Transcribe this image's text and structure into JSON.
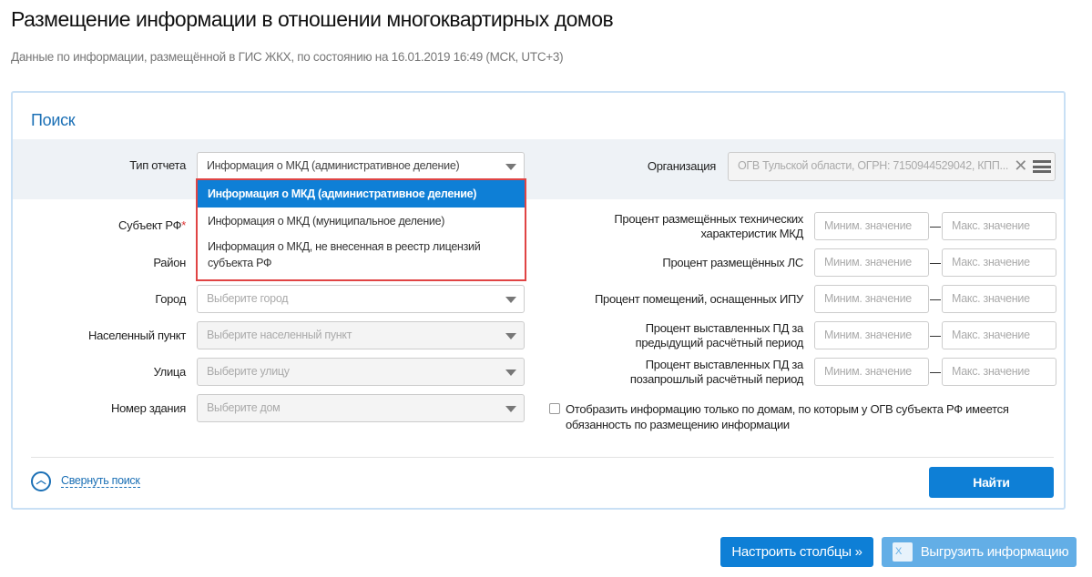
{
  "header": {
    "title": "Размещение информации в отношении многоквартирных домов",
    "subtitle": "Данные по информации, размещённой в ГИС ЖКХ, по состоянию на 16.01.2019 16:49 (МСК, UTC+3)"
  },
  "search": {
    "heading": "Поиск",
    "report_type": {
      "label": "Тип отчета",
      "value": "Информация о МКД (административное деление)",
      "options": [
        "Информация о МКД (административное деление)",
        "Информация о МКД (муниципальное деление)",
        "Информация о МКД, не внесенная в реестр лицензий субъекта РФ"
      ]
    },
    "organization": {
      "label": "Организация",
      "value": "ОГВ Тульской области, ОГРН: 7150944529042, КПП..."
    },
    "subject": {
      "label": "Субъект РФ",
      "required": "*"
    },
    "district": {
      "label": "Район"
    },
    "city": {
      "label": "Город",
      "placeholder": "Выберите город"
    },
    "settlement": {
      "label": "Населенный пункт",
      "placeholder": "Выберите населенный пункт"
    },
    "street": {
      "label": "Улица",
      "placeholder": "Выберите улицу"
    },
    "building": {
      "label": "Номер здания",
      "placeholder": "Выберите дом"
    },
    "ranges": [
      {
        "label": "Процент размещённых технических характеристик МКД",
        "min": "Миним. значение",
        "max": "Макс. значение"
      },
      {
        "label": "Процент размещённых ЛС",
        "min": "Миним. значение",
        "max": "Макс. значение"
      },
      {
        "label": "Процент помещений, оснащенных ИПУ",
        "min": "Миним. значение",
        "max": "Макс. значение"
      },
      {
        "label": "Процент выставленных ПД за предыдущий расчётный период",
        "min": "Миним. значение",
        "max": "Макс. значение"
      },
      {
        "label": "Процент выставленных ПД за позапрошлый расчётный период",
        "min": "Миним. значение",
        "max": "Макс. значение"
      }
    ],
    "checkbox_label": "Отобразить информацию только по домам, по которым у ОГВ субъекта РФ имеется обязанность по размещению информации",
    "collapse_label": "Свернуть поиск",
    "find_label": "Найти"
  },
  "actions": {
    "columns_label": "Настроить столбцы",
    "export_label": "Выгрузить информацию"
  }
}
